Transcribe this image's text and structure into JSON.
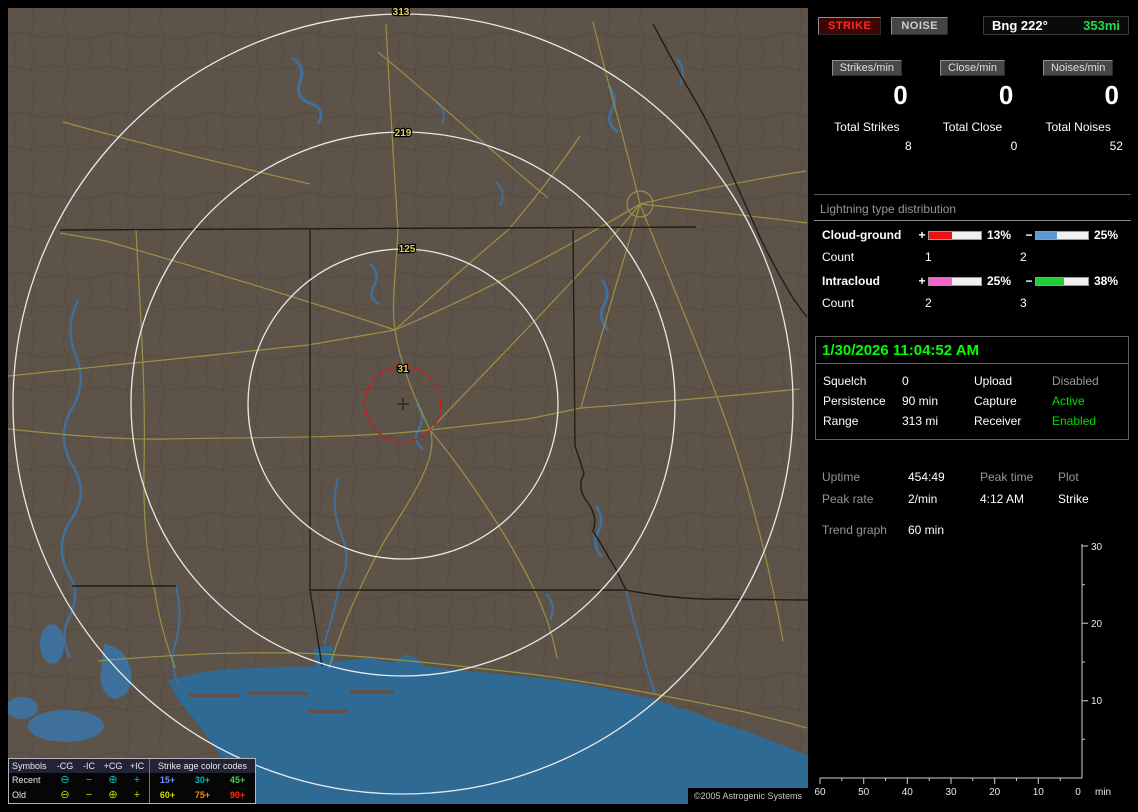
{
  "colors": {
    "timestamp_green": "#00ff00",
    "status_green": "#00dd00",
    "status_dim": "#9a9a9a",
    "strike_red": "#ff2a2a",
    "bearing_green": "#22dd44",
    "map_land": "#5e5349",
    "map_water": "#2f6a94",
    "range_ring": "#f0f0f0",
    "alarm_ring_red": "#e01010"
  },
  "map": {
    "range_labels": [
      "313",
      "219",
      "125",
      "31"
    ],
    "copyright": "©2005 Astrogenic Systems",
    "legend": {
      "symbols_title": "Symbols",
      "symbol_cols": [
        "-CG",
        "-IC",
        "+CG",
        "+IC"
      ],
      "age_title": "Strike age color codes",
      "symbol_glyphs": [
        "⊖",
        "−",
        "⊕",
        "+"
      ],
      "rows": [
        {
          "label": "Recent",
          "symbol_color": "#00c2c2",
          "ages": [
            {
              "text": "15+",
              "color": "#6f8fff"
            },
            {
              "text": "30+",
              "color": "#00bcbc"
            },
            {
              "text": "45+",
              "color": "#4ecc4e"
            }
          ]
        },
        {
          "label": "Old",
          "symbol_color": "#cfcf00",
          "ages": [
            {
              "text": "60+",
              "color": "#d8d800"
            },
            {
              "text": "75+",
              "color": "#ff8800"
            },
            {
              "text": "90+",
              "color": "#ff2e00"
            }
          ]
        }
      ]
    }
  },
  "panel": {
    "strike_button": "STRIKE",
    "noise_button": "NOISE",
    "bearing": {
      "label": "Bng 222°",
      "distance": "353mi"
    },
    "counters": [
      {
        "label": "Strikes/min",
        "value": "0",
        "total_label": "Total Strikes",
        "total": "8"
      },
      {
        "label": "Close/min",
        "value": "0",
        "total_label": "Total Close",
        "total": "0"
      },
      {
        "label": "Noises/min",
        "value": "0",
        "total_label": "Total Noises",
        "total": "52"
      }
    ],
    "distribution": {
      "title": "Lightning type distribution",
      "rows": [
        {
          "name": "Cloud-ground",
          "count_label": "Count",
          "plus": {
            "sign": "+",
            "pct": "13%",
            "fill": 44,
            "color": "#ee1111",
            "count": "1"
          },
          "minus": {
            "sign": "−",
            "pct": "25%",
            "fill": 40,
            "color": "#5b9bd5",
            "count": "2"
          }
        },
        {
          "name": "Intracloud",
          "count_label": "Count",
          "plus": {
            "sign": "+",
            "pct": "25%",
            "fill": 44,
            "color": "#ee66cc",
            "count": "2"
          },
          "minus": {
            "sign": "−",
            "pct": "38%",
            "fill": 54,
            "color": "#22cc33",
            "count": "3"
          }
        }
      ]
    },
    "timestamp": "1/30/2026 11:04:52 AM",
    "settings": [
      {
        "label": "Squelch",
        "value": "0",
        "label2": "Upload",
        "value2": "Disabled",
        "value2_color": "#9a9a9a"
      },
      {
        "label": "Persistence",
        "value": "90 min",
        "label2": "Capture",
        "value2": "Active",
        "value2_color": "#00dd00"
      },
      {
        "label": "Range",
        "value": "313 mi",
        "label2": "Receiver",
        "value2": "Enabled",
        "value2_color": "#00dd00"
      }
    ],
    "stats": {
      "uptime_label": "Uptime",
      "uptime_value": "454:49",
      "peak_time_label": "Peak time",
      "plot_label": "Plot",
      "peak_rate_label": "Peak rate",
      "peak_rate_value": "2/min",
      "peak_time_value": "4:12 AM",
      "plot_value": "Strike",
      "trend_label": "Trend graph",
      "trend_value": "60 min"
    },
    "trend_chart": {
      "y_ticks": [
        "30",
        "20",
        "10"
      ],
      "x_ticks": [
        "60",
        "50",
        "40",
        "30",
        "20",
        "10",
        "0"
      ],
      "x_unit": "min",
      "y_max": 30,
      "x_range_min": 60
    }
  }
}
